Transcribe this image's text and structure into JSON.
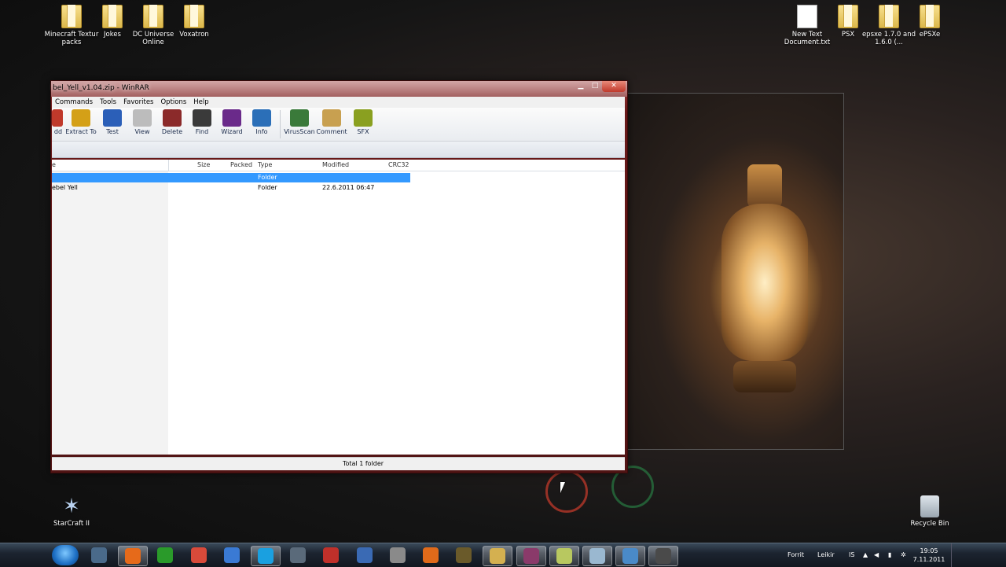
{
  "desktop": {
    "icons_top_left": [
      {
        "label": "Minecraft Textur packs",
        "kind": "folder"
      },
      {
        "label": "Jokes",
        "kind": "folder"
      },
      {
        "label": "DC Universe Online",
        "kind": "folder"
      },
      {
        "label": "Voxatron",
        "kind": "folder"
      }
    ],
    "icons_top_right": [
      {
        "label": "New Text Document.txt",
        "kind": "text-file"
      },
      {
        "label": "PSX",
        "kind": "folder"
      },
      {
        "label": "epsxe 1.7.0 and 1.6.0 (...",
        "kind": "folder"
      },
      {
        "label": "ePSXe",
        "kind": "folder"
      }
    ],
    "starcraft_label": "StarCraft II",
    "recycle_label": "Recycle Bin"
  },
  "window": {
    "title": "bel_Yell_v1.04.zip - WinRAR",
    "minimize": "▁",
    "maximize": "□",
    "close": "✕",
    "menu": [
      "Commands",
      "Tools",
      "Favorites",
      "Options",
      "Help"
    ],
    "toolbar": [
      {
        "label": "dd",
        "icon": "add-icon",
        "color": "#c0392b"
      },
      {
        "label": "Extract To",
        "icon": "extract-icon",
        "color": "#d4a017"
      },
      {
        "label": "Test",
        "icon": "test-icon",
        "color": "#2b5fb8"
      },
      {
        "label": "View",
        "icon": "view-icon",
        "color": "#8a8a8a"
      },
      {
        "label": "Delete",
        "icon": "delete-icon",
        "color": "#8b2a2a"
      },
      {
        "label": "Find",
        "icon": "find-icon",
        "color": "#3a3a3a"
      },
      {
        "label": "Wizard",
        "icon": "wizard-icon",
        "color": "#6a2a8a"
      },
      {
        "label": "Info",
        "icon": "info-icon",
        "color": "#2b6fb8"
      },
      {
        "label": "VirusScan",
        "icon": "virusscan-icon",
        "color": "#3a7a3a"
      },
      {
        "label": "Comment",
        "icon": "comment-icon",
        "color": "#c8a050"
      },
      {
        "label": "SFX",
        "icon": "sfx-icon",
        "color": "#8aa020"
      }
    ],
    "columns": {
      "name": "e",
      "size": "Size",
      "packed": "Packed",
      "type": "Type",
      "modified": "Modified",
      "crc": "CRC32"
    },
    "rows": [
      {
        "name": "",
        "type": "Folder",
        "modified": "",
        "selected": true
      },
      {
        "name": "ebel Yell",
        "type": "Folder",
        "modified": "22.6.2011 06:47",
        "selected": false
      }
    ],
    "status_left": "",
    "status_total": "Total 1 folder"
  },
  "taskbar": {
    "apps": [
      {
        "name": "starcraft",
        "color": "#4a6a8a"
      },
      {
        "name": "firefox",
        "color": "#e66a1a",
        "active": true
      },
      {
        "name": "utorrent",
        "color": "#2a9a2a"
      },
      {
        "name": "chrome",
        "color": "#d94a3a"
      },
      {
        "name": "itunes",
        "color": "#3a7ad4"
      },
      {
        "name": "skype",
        "color": "#1aa0e0",
        "active": true
      },
      {
        "name": "steam",
        "color": "#5a6a7a"
      },
      {
        "name": "app-red",
        "color": "#c0302a"
      },
      {
        "name": "app-blue",
        "color": "#3a6ab4"
      },
      {
        "name": "gamepad",
        "color": "#8a8a8a"
      },
      {
        "name": "origin",
        "color": "#e06a1a"
      },
      {
        "name": "minecraft",
        "color": "#6a5a2a"
      },
      {
        "name": "explorer",
        "color": "#d4b050",
        "active": true
      },
      {
        "name": "winrar",
        "color": "#8a3a6a",
        "active": true
      },
      {
        "name": "notepad",
        "color": "#b8c860",
        "active": true
      },
      {
        "name": "app-glass",
        "color": "#9ab8d0",
        "active": true
      },
      {
        "name": "app-window",
        "color": "#4a8ac8",
        "active": true
      },
      {
        "name": "app-dark",
        "color": "#4a4a4a",
        "active": true
      }
    ],
    "tray": {
      "forrit": "Forrit",
      "leikir": "Leikir",
      "lang": "IS"
    },
    "clock_time": "19:05",
    "clock_date": "7.11.2011"
  },
  "colors": {
    "selection": "#3399ff",
    "title_bar": "#7a2020"
  }
}
